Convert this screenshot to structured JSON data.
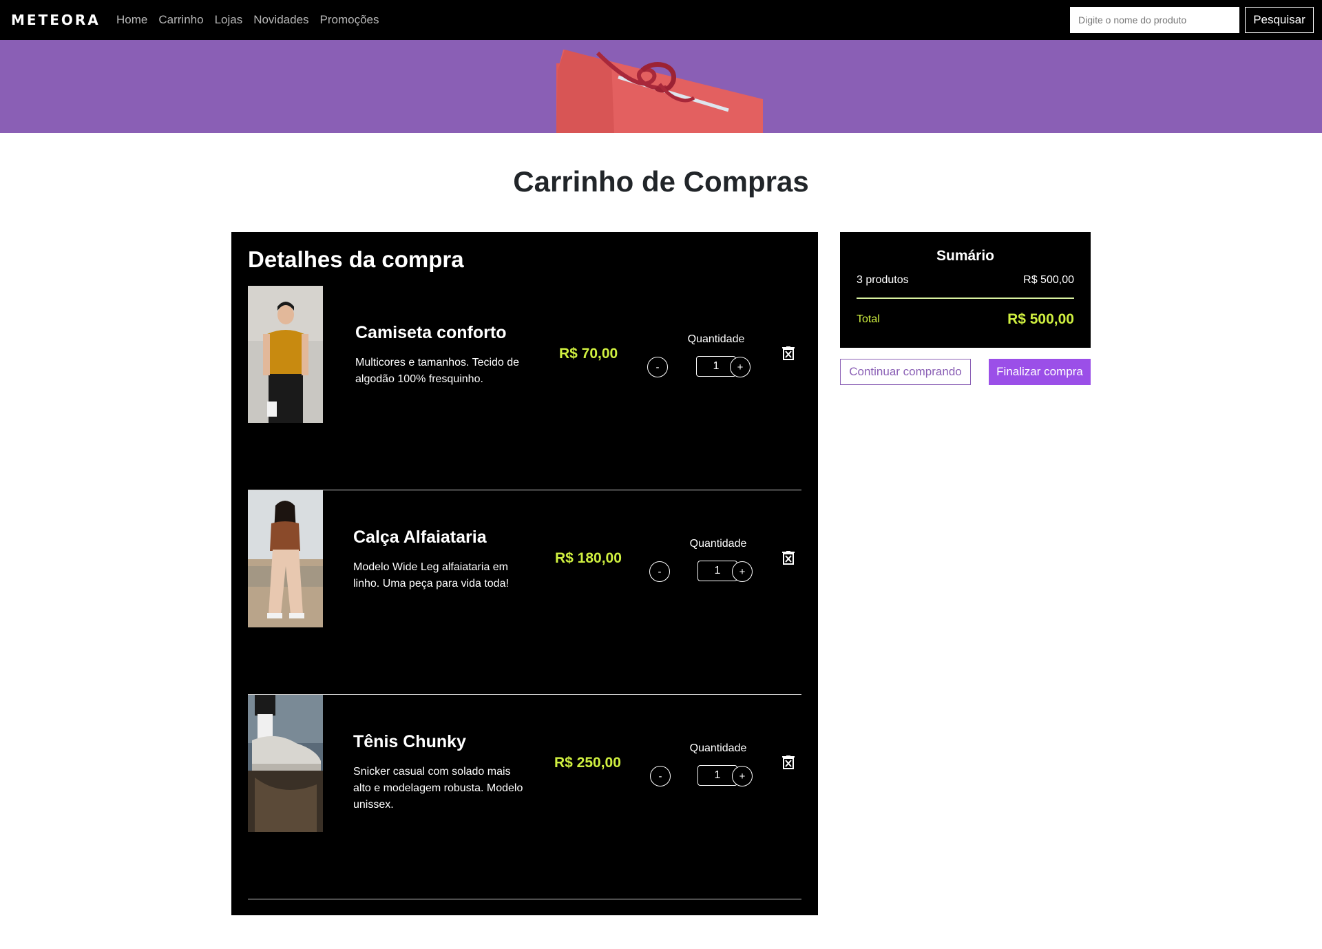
{
  "navbar": {
    "logo": "METEORA",
    "links": [
      "Home",
      "Carrinho",
      "Lojas",
      "Novidades",
      "Promoções"
    ],
    "search_placeholder": "Digite o nome do produto",
    "search_button": "Pesquisar"
  },
  "page_title": "Carrinho de Compras",
  "details": {
    "title": "Detalhes da compra",
    "quantity_label": "Quantidade",
    "minus_label": "-",
    "plus_label": "+",
    "items": [
      {
        "name": "Camiseta conforto",
        "description": "Multicores e tamanhos. Tecido de algodão 100% fresquinho.",
        "price": "R$ 70,00",
        "quantity": "1"
      },
      {
        "name": "Calça Alfaiataria",
        "description": "Modelo Wide Leg alfaiataria em linho. Uma peça para vida toda!",
        "price": "R$ 180,00",
        "quantity": "1"
      },
      {
        "name": "Tênis Chunky",
        "description": "Snicker casual com solado mais alto e modelagem robusta. Modelo unissex.",
        "price": "R$ 250,00",
        "quantity": "1"
      }
    ]
  },
  "summary": {
    "title": "Sumário",
    "count": "3 produtos",
    "subtotal": "R$ 500,00",
    "total_label": "Total",
    "total_value": "R$ 500,00"
  },
  "actions": {
    "continue": "Continuar comprando",
    "finish": "Finalizar compra"
  },
  "colors": {
    "accent": "#9b4fe8",
    "banner": "#8a5fb5",
    "price": "#d0f040"
  }
}
